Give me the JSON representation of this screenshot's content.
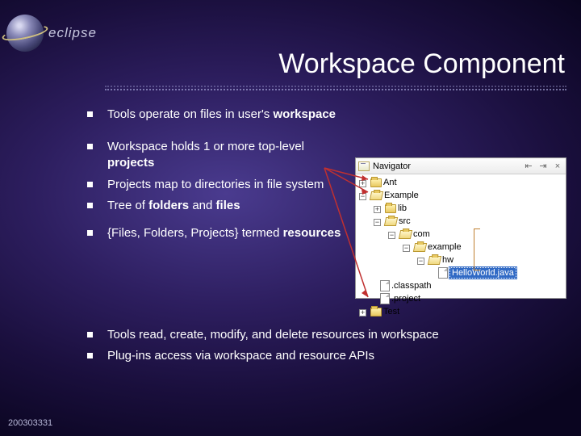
{
  "logo_text": "eclipse",
  "title": "Workspace Component",
  "bullets": {
    "b1_pre": "Tools operate on files in user's ",
    "b1_bold": "workspace",
    "b2_pre": "Workspace holds 1 or more top-level ",
    "b2_bold": "projects",
    "b3": "Projects map to directories in file system",
    "b4_a": "Tree of ",
    "b4_b": "folders",
    "b4_c": " and ",
    "b4_d": "files",
    "b5_a": "{Files, Folders, Projects} termed ",
    "b5_b": "resources",
    "b6": "Tools read, create, modify, and delete resources in workspace",
    "b7": "Plug-ins access via workspace and resource APIs"
  },
  "navigator": {
    "title": "Navigator",
    "items": {
      "ant": "Ant",
      "example": "Example",
      "lib": "lib",
      "src": "src",
      "com": "com",
      "example2": "example",
      "hw": "hw",
      "hello": "HelloWorld.java",
      "classpath": ".classpath",
      "project": ".project",
      "test": "Test"
    }
  },
  "footer": "200303331"
}
